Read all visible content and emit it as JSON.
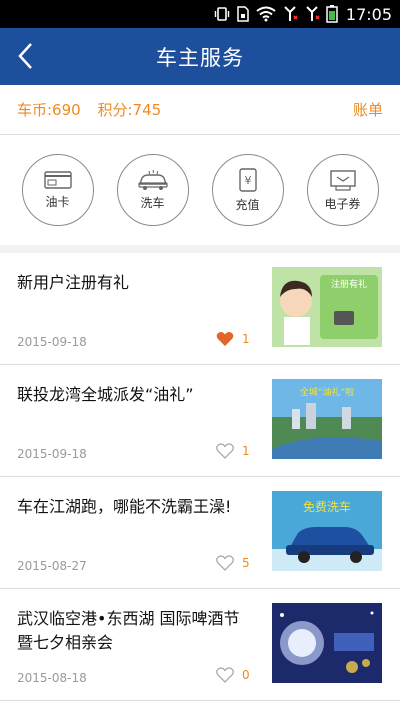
{
  "status_bar": {
    "time": "17:05",
    "icons": [
      "vibrate-icon",
      "sim-icon",
      "wifi-icon",
      "signal-icon",
      "signal-icon",
      "battery-icon"
    ]
  },
  "header": {
    "title": "车主服务",
    "back_icon": "chevron-left-icon"
  },
  "account": {
    "coins": "车币:690",
    "points": "积分:745",
    "bill_label": "账单"
  },
  "services": [
    {
      "label": "油卡",
      "icon": "fuel-card-icon"
    },
    {
      "label": "洗车",
      "icon": "car-wash-icon"
    },
    {
      "label": "充值",
      "icon": "recharge-icon"
    },
    {
      "label": "电子券",
      "icon": "e-coupon-icon"
    }
  ],
  "articles": [
    {
      "title": "新用户注册有礼",
      "date": "2015-09-18",
      "likes": "1",
      "liked": true,
      "thumb_text": "注册有礼",
      "thumb_bg": "#bfe3a6"
    },
    {
      "title": "联投龙湾全城派发“油礼”",
      "date": "2015-09-18",
      "likes": "1",
      "liked": false,
      "thumb_text": "全城“油礼”啦",
      "thumb_bg": "#3b8cc9"
    },
    {
      "title": "车在江湖跑，哪能不洗霸王澡!",
      "date": "2015-08-27",
      "likes": "5",
      "liked": false,
      "thumb_text": "免费洗车",
      "thumb_bg": "#4aa8d8"
    },
    {
      "title": "武汉临空港•东西湖 国际啤酒节暨七夕相亲会",
      "date": "2015-08-18",
      "likes": "0",
      "liked": false,
      "thumb_text": "",
      "thumb_bg": "#1c2a6b"
    }
  ],
  "colors": {
    "header_bg": "#1d4f9c",
    "accent": "#f08a1e",
    "liked": "#e2652a"
  }
}
